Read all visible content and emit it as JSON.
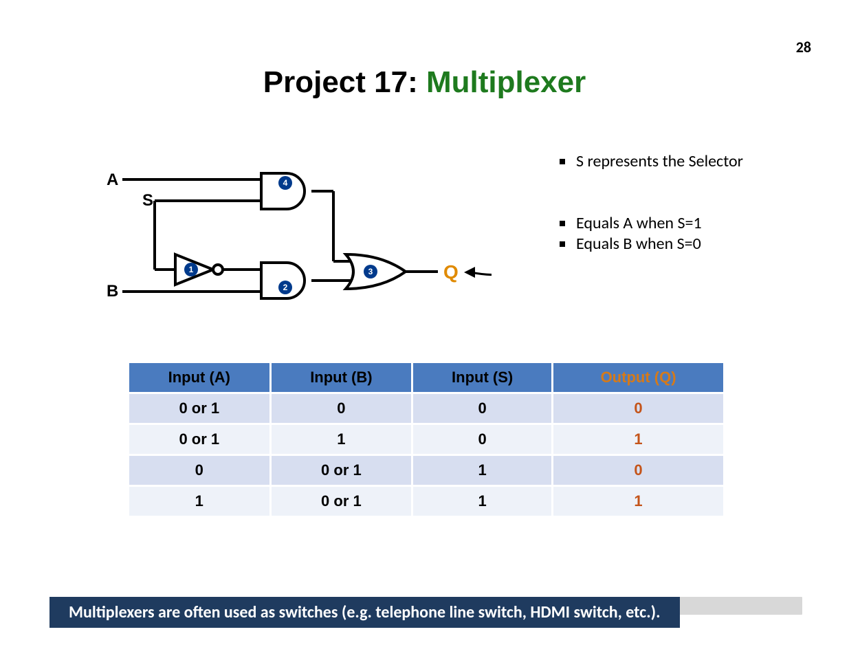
{
  "page_number": "28",
  "title": {
    "prefix": "Project 17: ",
    "name": "Multiplexer"
  },
  "diagram": {
    "labels": {
      "A": "A",
      "S": "S",
      "B": "B",
      "Q": "Q"
    },
    "gate_numbers": {
      "not": "1",
      "and_bottom": "2",
      "or": "3",
      "and_top": "4"
    }
  },
  "notes": {
    "item1": "S represents the Selector",
    "item2": "Equals A when S=1",
    "item3": "Equals B when S=0"
  },
  "table": {
    "headers": {
      "a": "Input (A)",
      "b": "Input (B)",
      "s": "Input (S)",
      "q": "Output (Q)"
    },
    "rows": [
      {
        "a": "0 or 1",
        "b": "0",
        "s": "0",
        "q": "0"
      },
      {
        "a": "0 or 1",
        "b": "1",
        "s": "0",
        "q": "1"
      },
      {
        "a": "0",
        "b": "0 or 1",
        "s": "1",
        "q": "0"
      },
      {
        "a": "1",
        "b": "0 or 1",
        "s": "1",
        "q": "1"
      }
    ]
  },
  "footer": "Multiplexers are often used as switches (e.g. telephone line switch, HDMI switch, etc.)."
}
